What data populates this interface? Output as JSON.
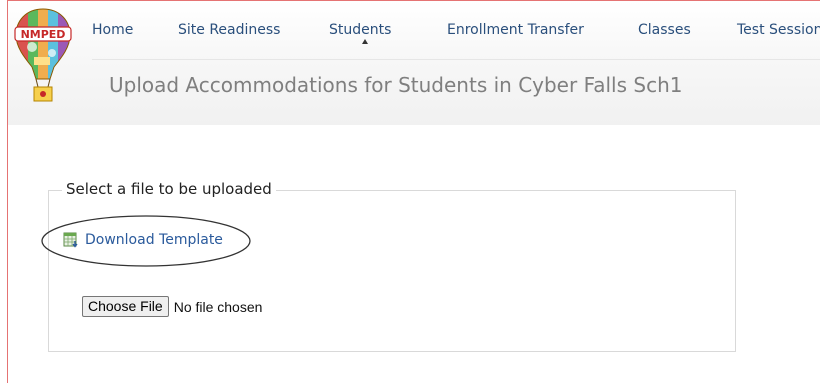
{
  "brand": {
    "logo_text": "NMPED"
  },
  "nav": {
    "items": [
      {
        "label": "Home"
      },
      {
        "label": "Site Readiness"
      },
      {
        "label": "Students",
        "active": true
      },
      {
        "label": "Enrollment Transfer"
      },
      {
        "label": "Classes"
      },
      {
        "label": "Test Sessions"
      }
    ]
  },
  "page": {
    "title": "Upload Accommodations for Students in Cyber Falls Sch1"
  },
  "upload": {
    "legend": "Select a file to be uploaded",
    "template_link": "Download Template",
    "choose_button": "Choose File",
    "file_status": "No file chosen"
  },
  "colors": {
    "nav_link": "#2a4f7c",
    "title": "#7f7f7f",
    "link": "#2a5a9c",
    "frame": "#e57373"
  },
  "icons": {
    "template": "spreadsheet-download-icon",
    "caret": "caret-up-icon"
  }
}
